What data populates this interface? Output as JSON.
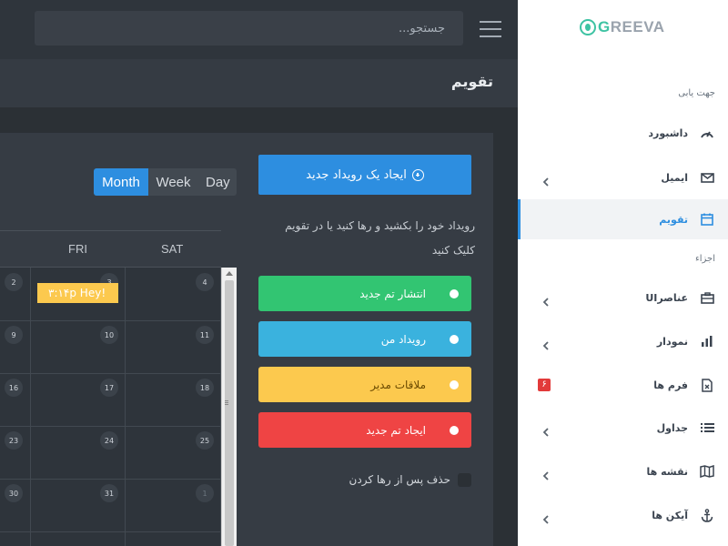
{
  "app": {
    "logo": "GREEVA"
  },
  "header": {
    "search_placeholder": "جستجو...",
    "page_title": "تقویم"
  },
  "sidebar": {
    "section_navigation": "جهت یابی",
    "section_components": "اجزاء",
    "items": [
      {
        "label": "داشبورد",
        "icon": "gauge-icon",
        "has_submenu": false
      },
      {
        "label": "ایمیل",
        "icon": "envelope-icon",
        "has_submenu": true
      },
      {
        "label": "تقویم",
        "icon": "calendar-icon",
        "has_submenu": false,
        "active": true
      },
      {
        "label": "عناصرUI",
        "icon": "briefcase-icon",
        "has_submenu": true
      },
      {
        "label": "نمودار",
        "icon": "bar-chart-icon",
        "has_submenu": true
      },
      {
        "label": "فرم ها",
        "icon": "form-file-icon",
        "badge": "۶"
      },
      {
        "label": "جداول",
        "icon": "list-icon",
        "has_submenu": true
      },
      {
        "label": "نقشه ها",
        "icon": "map-icon",
        "has_submenu": true
      },
      {
        "label": "آیکن ها",
        "icon": "anchor-icon",
        "has_submenu": true
      }
    ]
  },
  "calendar_panel": {
    "create_button": "ایجاد یک رویداد جدید",
    "help_text": "رویداد خود را بکشید و رها کنید یا در تقویم کلیک کنید",
    "events": [
      {
        "label": "انتشار تم جدید",
        "color": "#32c572"
      },
      {
        "label": "رویداد من",
        "color": "#3ab2de"
      },
      {
        "label": "ملاقات مدیر",
        "color": "#fcc94e"
      },
      {
        "label": "ایجاد تم جدید",
        "color": "#ef4444"
      }
    ],
    "remove_after_drop": "حذف پس از رها کردن"
  },
  "calendar": {
    "views": {
      "month": "Month",
      "week": "Week",
      "day": "Day"
    },
    "active_view": "Month",
    "day_names": {
      "fri": "FRI",
      "sat": "SAT"
    },
    "weeks": [
      [
        "2",
        "3",
        "4"
      ],
      [
        "9",
        "10",
        "11"
      ],
      [
        "16",
        "17",
        "18"
      ],
      [
        "23",
        "24",
        "25"
      ],
      [
        "30",
        "31",
        "1"
      ],
      [
        "",
        "",
        ""
      ]
    ],
    "event": {
      "label": "۳:۱۴p Hey!",
      "color": "#fcc94e"
    }
  }
}
